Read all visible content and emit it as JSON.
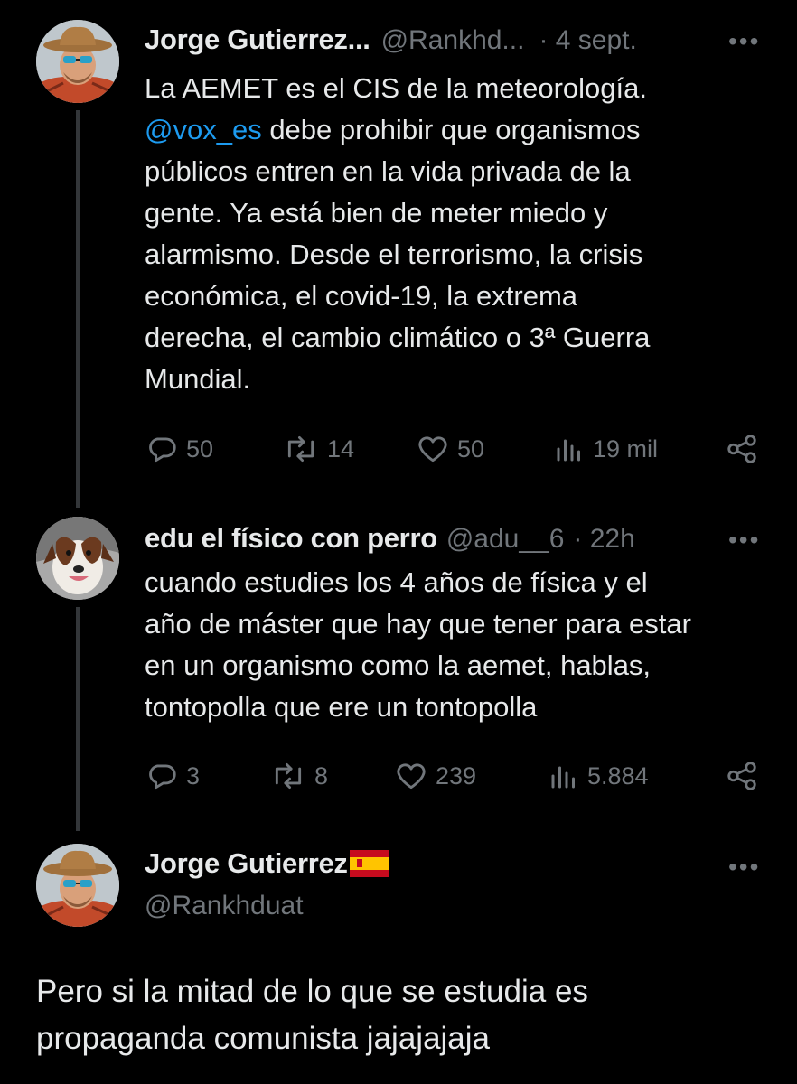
{
  "tweets": [
    {
      "name": "Jorge Gutierrez...",
      "handle": "@Rankhd...",
      "time": "· 4 sept.",
      "mention": "@vox_es",
      "line1": "La AEMET es el CIS de la meteorología.",
      "text_after_mention": " debe prohibir que organismos",
      "rest_lines": [
        "públicos entren en la vida privada de la",
        "gente. Ya está bien de meter miedo y",
        "alarmismo. Desde el terrorismo, la crisis",
        "económica, el covid-19, la extrema",
        "derecha, el cambio climático o 3ª Guerra",
        "Mundial."
      ],
      "replies": "50",
      "retweets": "14",
      "likes": "50",
      "views": "19 mil"
    },
    {
      "name": "edu el físico con perro",
      "handle": "@adu__6",
      "time": "· 22h",
      "lines": [
        "cuando estudies los 4 años de física y el",
        "año de máster que hay que tener para estar",
        "en un organismo como la aemet, hablas,",
        "tontopolla que ere un tontopolla"
      ],
      "replies": "3",
      "retweets": "8",
      "likes": "239",
      "views": "5.884"
    },
    {
      "name": "Jorge Gutierrez",
      "handle": "@Rankhduat",
      "lines": [
        "Pero si la mitad de lo que se estudia es",
        "propaganda comunista jajajajaja"
      ]
    }
  ],
  "icons": {
    "reply": "reply-icon",
    "retweet": "retweet-icon",
    "like": "heart-icon",
    "views": "views-icon",
    "share": "share-icon",
    "more": "more-icon",
    "flag": "spain-flag-icon"
  },
  "colors": {
    "background": "#000000",
    "text": "#e7e9ea",
    "muted": "#71767b",
    "link": "#1d9bf0"
  }
}
